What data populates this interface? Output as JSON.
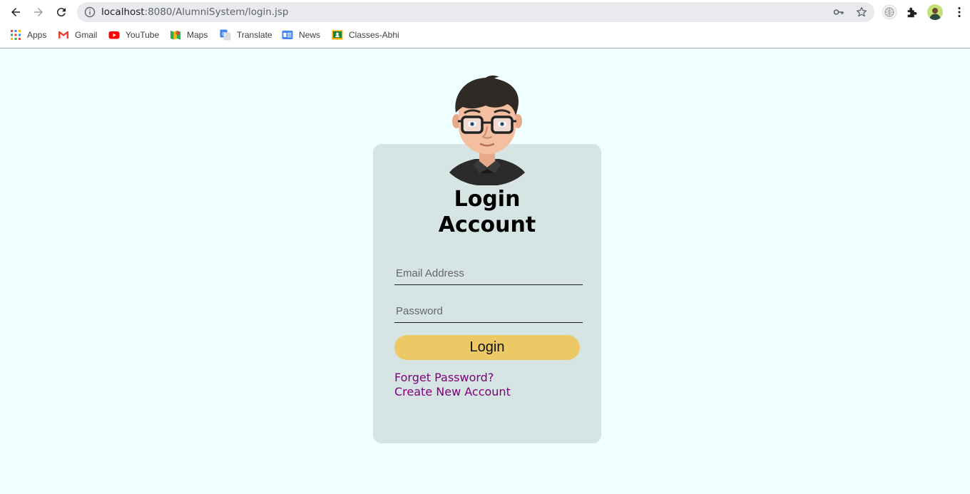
{
  "browser": {
    "url_host": "localhost",
    "url_rest": ":8080/AlumniSystem/login.jsp",
    "bookmarks": [
      {
        "label": "Apps",
        "icon": "apps-grid-icon"
      },
      {
        "label": "Gmail",
        "icon": "gmail-icon"
      },
      {
        "label": "YouTube",
        "icon": "youtube-icon"
      },
      {
        "label": "Maps",
        "icon": "maps-icon"
      },
      {
        "label": "Translate",
        "icon": "translate-icon"
      },
      {
        "label": "News",
        "icon": "news-icon"
      },
      {
        "label": "Classes-Abhi",
        "icon": "classroom-icon"
      }
    ]
  },
  "login": {
    "title_line1": "Login",
    "title_line2": "Account",
    "email_placeholder": "Email Address",
    "password_placeholder": "Password",
    "button_label": "Login",
    "forgot_link": "Forget Password?",
    "create_link": "Create New Account"
  },
  "colors": {
    "page_bg": "#f0ffff",
    "card_bg": "#d7e4e4",
    "button_bg": "#edc966",
    "link": "#800080"
  }
}
